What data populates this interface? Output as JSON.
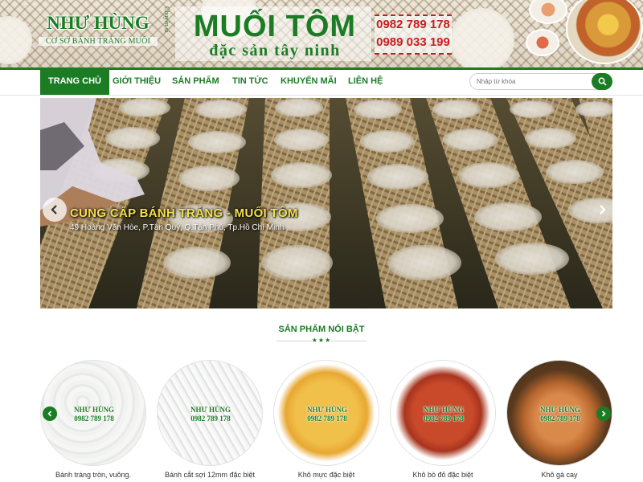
{
  "header": {
    "logo_title": "NHƯ HÙNG",
    "logo_subtitle": "CƠ SỞ BÁNH TRÁNG MUỐI",
    "vertical_tag": "Chuyên sỉ",
    "brand_title": "MUỐI TÔM",
    "brand_subtitle": "đặc sản tây ninh",
    "phones": [
      "0982 789 178",
      "0989 033 199"
    ]
  },
  "nav": {
    "items": [
      "TRANG CHỦ",
      "GIỚI THIỆU",
      "SẢN PHẨM",
      "TIN TỨC",
      "KHUYẾN MÃI",
      "LIÊN HỆ"
    ],
    "active_index": 0
  },
  "search": {
    "placeholder": "Nhập từ khóa",
    "icon": "search-icon"
  },
  "slider": {
    "caption_title": "CUNG CẤP BÁNH TRÁNG - MUỐI TÔM",
    "caption_address": "49 Hoàng Văn Hòe, P.Tân Quý, Q.Tân Phú, Tp.Hồ Chí Minh",
    "prev_icon": "chevron-left-icon",
    "next_icon": "chevron-right-icon"
  },
  "featured": {
    "title": "SẢN PHẨM NỔI BẬT",
    "stars": "★★★",
    "watermark_name": "NHƯ HÙNG",
    "watermark_phone": "0982 789 178",
    "products": [
      {
        "name": "Bánh tráng tròn, vuông."
      },
      {
        "name": "Bánh cắt sợi 12mm đặc biệt"
      },
      {
        "name": "Khô mực đặc biệt"
      },
      {
        "name": "Khô bò đỏ đặc biệt"
      },
      {
        "name": "Khô gà cay"
      }
    ]
  },
  "colors": {
    "brand_green": "#1b7c24",
    "phone_red": "#c71f1f",
    "caption_yellow": "#f4e04a"
  }
}
